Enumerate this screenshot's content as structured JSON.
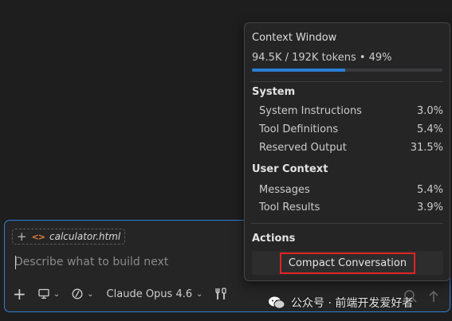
{
  "chat": {
    "file_chip": {
      "plus": "+",
      "code_icon": "<>",
      "name": "calculator.html"
    },
    "placeholder": "Describe what to build next",
    "toolbar": {
      "add_icon": "plus-icon",
      "device_icon": "monitor-icon",
      "mode_icon": "slash-circle-icon",
      "model_label": "Claude Opus 4.6",
      "tools_icon": "tools-icon"
    },
    "send_icon": "arrow-up-icon",
    "mic_icon": "search-icon"
  },
  "context_popup": {
    "title": "Context Window",
    "usage": "94.5K / 192K tokens • 49%",
    "usage_fraction": 0.49,
    "sections": {
      "system": {
        "heading": "System",
        "rows": [
          {
            "label": "System Instructions",
            "value": "3.0%"
          },
          {
            "label": "Tool Definitions",
            "value": "5.4%"
          },
          {
            "label": "Reserved Output",
            "value": "31.5%"
          }
        ]
      },
      "user": {
        "heading": "User Context",
        "rows": [
          {
            "label": "Messages",
            "value": "5.4%"
          },
          {
            "label": "Tool Results",
            "value": "3.9%"
          }
        ]
      },
      "actions": {
        "heading": "Actions",
        "compact_label": "Compact Conversation"
      }
    }
  },
  "watermark": {
    "text": "公众号 · 前端开发爱好者"
  },
  "colors": {
    "accent": "#2a7fd4",
    "highlight_border": "#e02424",
    "background": "#1e1e1e"
  }
}
